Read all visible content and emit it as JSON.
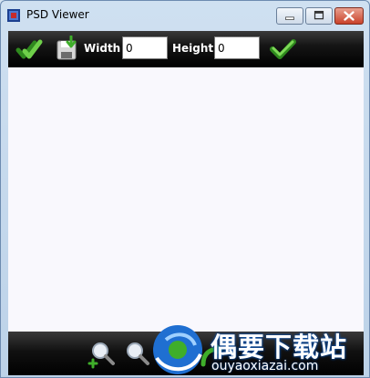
{
  "window": {
    "title": "PSD Viewer",
    "app_icon": "psd-app-icon"
  },
  "titlebar_buttons": {
    "minimize_icon": "minimize-icon",
    "maximize_icon": "maximize-icon",
    "close_icon": "close-icon"
  },
  "toolbar": {
    "open_icon": "double-checkmark-icon",
    "save_icon": "save-download-icon",
    "width_label": "Width",
    "width_value": "0",
    "height_label": "Height",
    "height_value": "0",
    "apply_icon": "checkmark-icon"
  },
  "bottombar": {
    "zoom_in_icon": "zoom-in-icon",
    "zoom_out_icon": "zoom-out-icon",
    "rotate_left_icon": "rotate-left-icon",
    "rotate_right_icon": "rotate-right-icon"
  },
  "watermark": {
    "logo": "ouyaoxiazai-logo",
    "text": "偶要下载站",
    "url": "ouyaoxiazai.com"
  },
  "colors": {
    "toolbar_bg": "#000000",
    "canvas_bg": "#f9f8fd",
    "accent_green": "#3fae2a",
    "frame_blue": "#bcd2e8"
  }
}
